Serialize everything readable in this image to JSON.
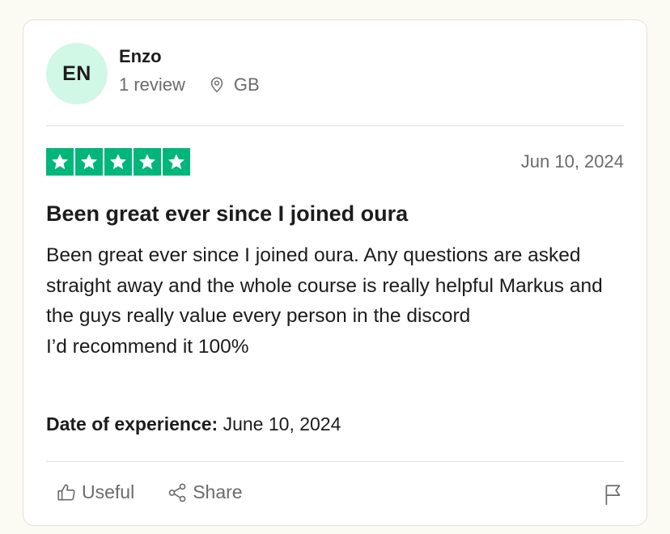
{
  "reviewer": {
    "initials": "EN",
    "name": "Enzo",
    "review_count": "1 review",
    "country": "GB"
  },
  "review": {
    "rating": 5,
    "date": "Jun 10, 2024",
    "title": "Been great ever since I joined oura",
    "body": "Been great ever since I joined oura. Any questions are asked straight away and the whole course is really helpful Markus and the guys really value every person in the discord\nI’d recommend it 100%",
    "experience_label": "Date of experience:",
    "experience_date": "June 10, 2024"
  },
  "actions": {
    "useful_label": "Useful",
    "share_label": "Share"
  },
  "colors": {
    "star_green": "#00b67a",
    "avatar_bg": "#d1f7e6"
  }
}
